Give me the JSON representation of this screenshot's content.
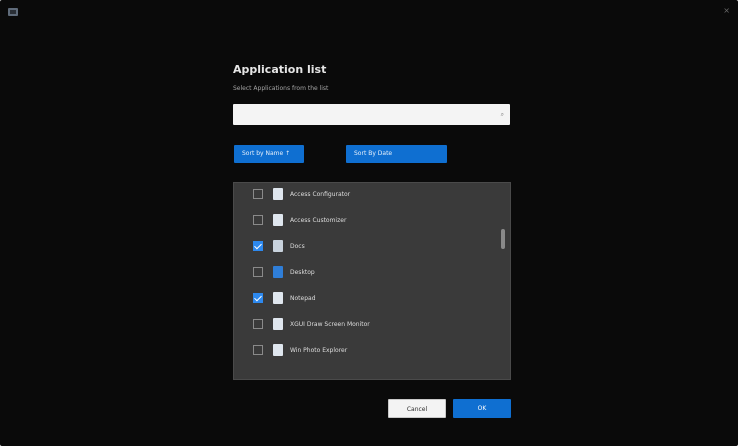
{
  "window": {
    "close_glyph": "×",
    "corner_icon": "app-window-icon"
  },
  "dialog": {
    "title": "Application list",
    "subtitle": "Select Applications from the list",
    "search": {
      "value": "",
      "placeholder": "",
      "icon": "search-icon",
      "glyph": "⌕"
    },
    "buttons": {
      "left": "Sort by Name ↑",
      "right": "Sort By Date"
    },
    "list": [
      {
        "label": "Access Configurator",
        "checked": false,
        "icon": "app-icon-doc"
      },
      {
        "label": "Access Customizer",
        "checked": false,
        "icon": "app-icon-doc"
      },
      {
        "label": "Docs",
        "checked": true,
        "icon": "app-icon-folder"
      },
      {
        "label": "Desktop",
        "checked": false,
        "icon": "app-icon-blue"
      },
      {
        "label": "Notepad",
        "checked": true,
        "icon": "app-icon-doc"
      },
      {
        "label": "XGUI Draw Screen Monitor",
        "checked": false,
        "icon": "app-icon-doc"
      },
      {
        "label": "Win Photo Explorer",
        "checked": false,
        "icon": "app-icon-doc"
      }
    ],
    "footer": {
      "cancel": "Cancel",
      "ok": "OK"
    }
  },
  "colors": {
    "accent": "#0f6fd1",
    "list_bg": "#3a3a3a",
    "screen_bg": "#0a0a0a"
  }
}
